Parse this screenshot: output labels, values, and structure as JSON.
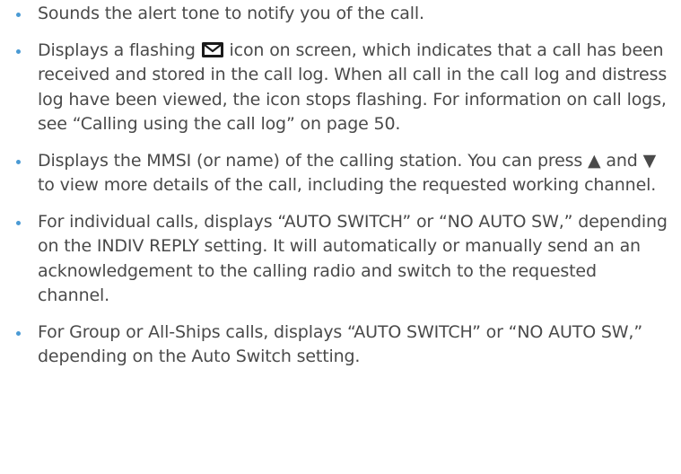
{
  "bullets": [
    {
      "text": "Sounds the alert tone to notify you of the call."
    },
    {
      "text_before_icon": "Displays a flashing ",
      "icon": "envelope-icon",
      "text_after_icon": " icon on screen, which indicates that a call has been received and stored in the call log. When all call in the call log and distress log have been viewed, the icon stops flashing.  For information on call logs, see “Calling using the call log” on page 50."
    },
    {
      "text": "Displays the MMSI (or name) of the calling station. You can press ▲ and ▼ to view more details of the call, including the requested working channel."
    },
    {
      "text": "For individual calls, displays “AUTO SWITCH” or “NO AUTO SW,” depending on the INDIV REPLY setting. It will automatically or manually send an an acknowledgement to the calling radio and switch to the requested channel."
    },
    {
      "text": "For Group or All-Ships calls, displays “AUTO SWITCH” or “NO AUTO SW,” depending on the Auto Switch setting."
    }
  ],
  "colors": {
    "text": "#4a4a4a",
    "bullet": "#4a9ad4"
  }
}
